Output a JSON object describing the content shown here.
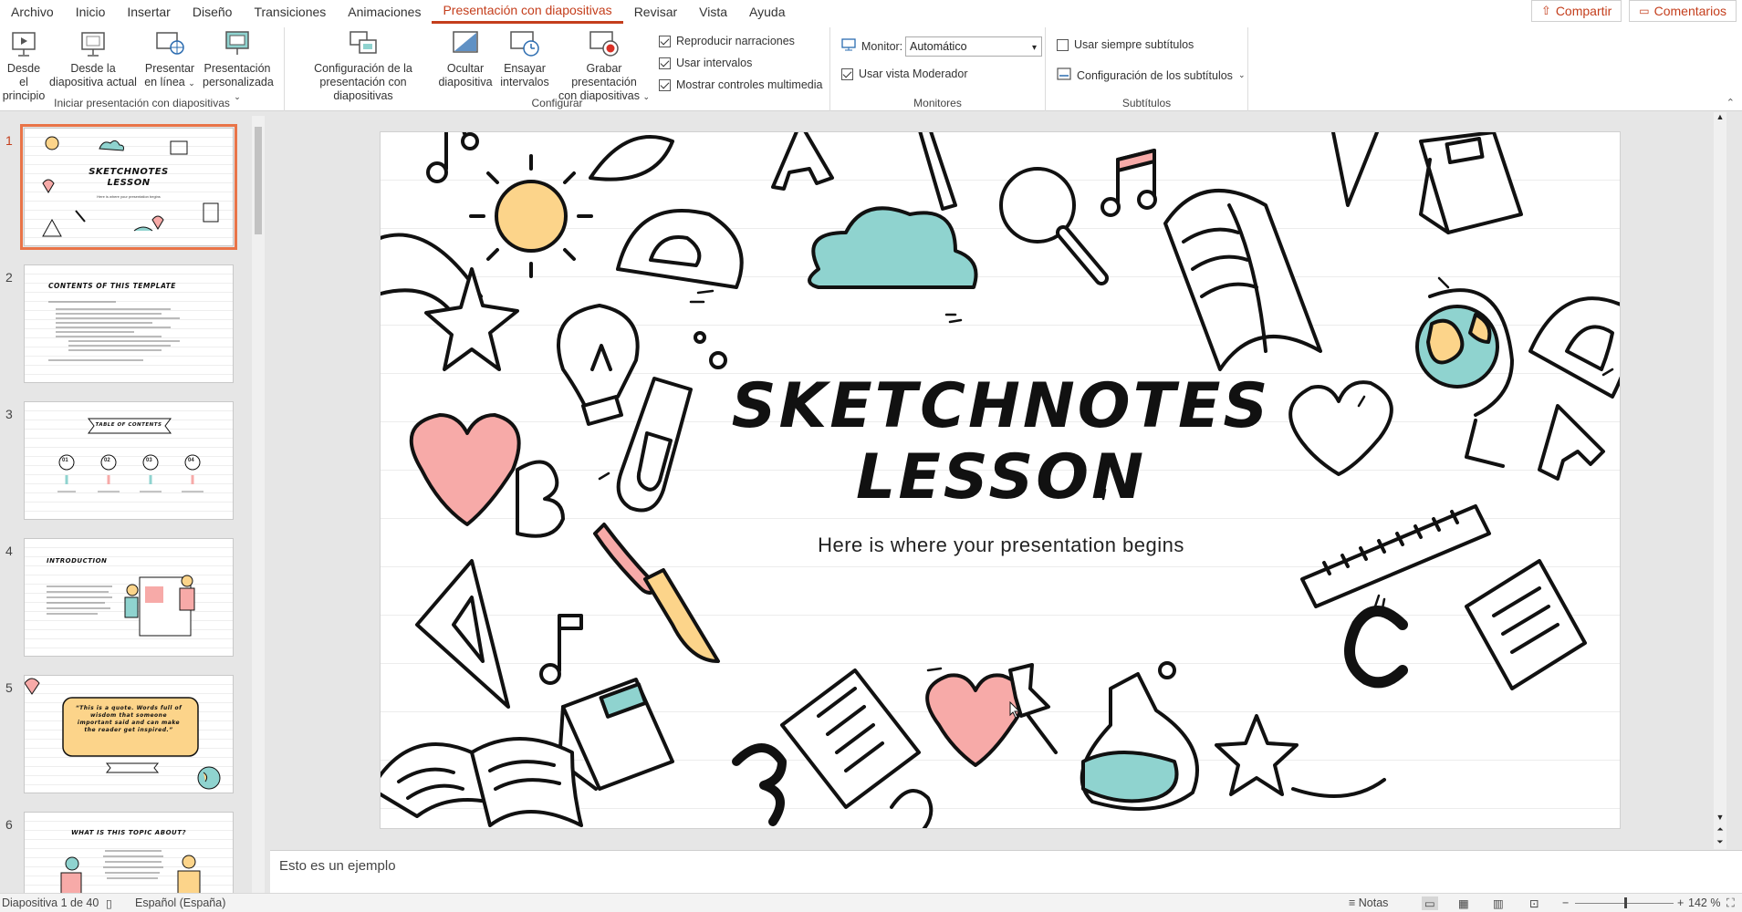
{
  "menu": {
    "tabs": [
      {
        "label": "Archivo"
      },
      {
        "label": "Inicio"
      },
      {
        "label": "Insertar"
      },
      {
        "label": "Diseño"
      },
      {
        "label": "Transiciones"
      },
      {
        "label": "Animaciones"
      },
      {
        "label": "Presentación con diapositivas"
      },
      {
        "label": "Revisar"
      },
      {
        "label": "Vista"
      },
      {
        "label": "Ayuda"
      }
    ],
    "active_tab": "Presentación con diapositivas",
    "share_label": "Compartir",
    "comments_label": "Comentarios"
  },
  "ribbon": {
    "start": {
      "group_label": "Iniciar presentación con diapositivas",
      "from_beginning": [
        "Desde el",
        "principio"
      ],
      "from_current": [
        "Desde la",
        "diapositiva actual"
      ],
      "online": [
        "Presentar",
        "en línea"
      ],
      "custom": [
        "Presentación",
        "personalizada"
      ]
    },
    "setup": {
      "group_label": "Configurar",
      "setup_show": [
        "Configuración de la",
        "presentación con diapositivas"
      ],
      "hide_slide": [
        "Ocultar",
        "diapositiva"
      ],
      "rehearse": [
        "Ensayar",
        "intervalos"
      ],
      "record": [
        "Grabar presentación",
        "con diapositivas"
      ],
      "checks": [
        {
          "label": "Reproducir narraciones",
          "checked": true
        },
        {
          "label": "Usar intervalos",
          "checked": true
        },
        {
          "label": "Mostrar controles multimedia",
          "checked": true
        }
      ]
    },
    "monitors": {
      "group_label": "Monitores",
      "monitor_label": "Monitor:",
      "monitor_value": "Automático",
      "presenter_view": {
        "label": "Usar vista Moderador",
        "checked": true
      }
    },
    "subtitles": {
      "group_label": "Subtítulos",
      "always_use": {
        "label": "Usar siempre subtítulos",
        "checked": false
      },
      "settings_label": "Configuración de los subtítulos"
    }
  },
  "thumbnails": [
    {
      "num": "1",
      "title": "SKETCHNOTES\nLESSON",
      "subtitle": "Here is where your presentation begins"
    },
    {
      "num": "2",
      "title": "CONTENTS OF THIS TEMPLATE"
    },
    {
      "num": "3",
      "title": "TABLE OF CONTENTS",
      "items": [
        "01",
        "02",
        "03",
        "04"
      ]
    },
    {
      "num": "4",
      "title": "INTRODUCTION"
    },
    {
      "num": "5",
      "title": "“This is a quote. Words full of wisdom that someone important said and can make the reader get inspired.”"
    },
    {
      "num": "6",
      "title": "WHAT IS THIS TOPIC ABOUT?"
    }
  ],
  "slide": {
    "title_line1": "SKETCHNOTES",
    "title_line2": "LESSON",
    "subtitle": "Here is where your presentation begins",
    "colors": {
      "sun": "#fcd48a",
      "teal": "#8fd3cf",
      "pink": "#f7aaa8",
      "ink": "#111111"
    }
  },
  "notes": {
    "text": "Esto es un ejemplo"
  },
  "status": {
    "slide_count": "Diapositiva 1 de 40",
    "language": "Español (España)",
    "notes_label": "Notas",
    "zoom": "142 %"
  }
}
